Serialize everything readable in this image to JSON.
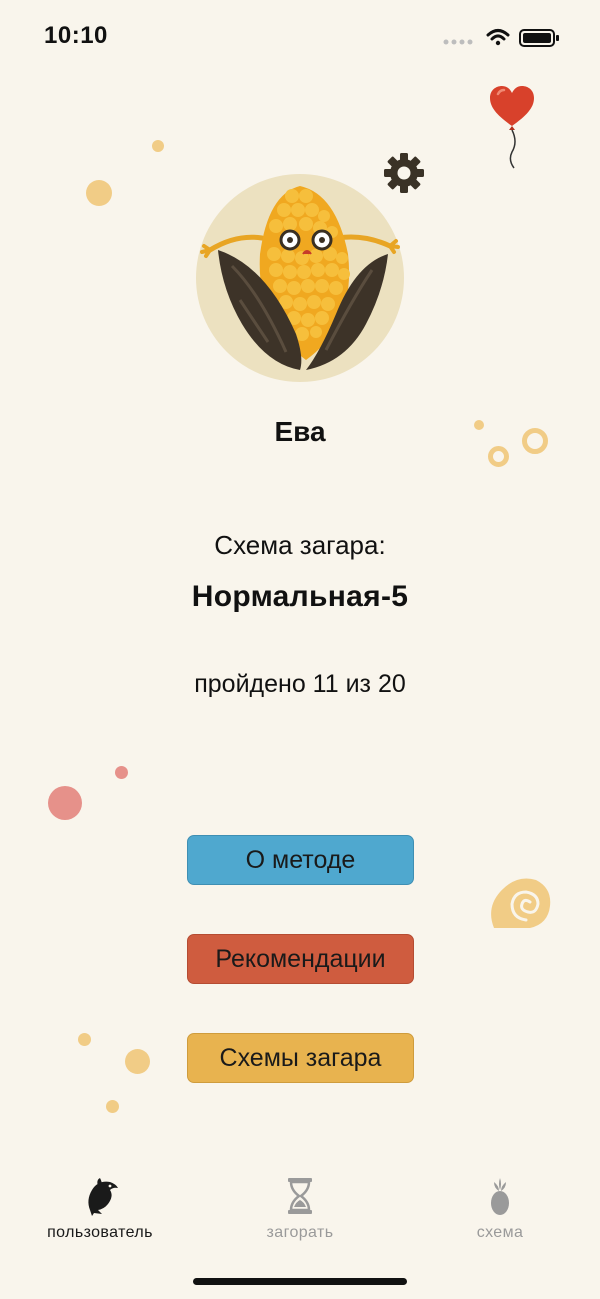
{
  "status_bar": {
    "time": "10:10"
  },
  "profile": {
    "name": "Ева"
  },
  "scheme": {
    "label": "Схема загара:",
    "name": "Нормальная-5",
    "progress_text": "пройдено 11 из 20",
    "completed": 11,
    "total": 20
  },
  "buttons": [
    {
      "label": "О методе",
      "color": "#4fa8cf"
    },
    {
      "label": "Рекомендации",
      "color": "#cf5c3f"
    },
    {
      "label": "Схемы загара",
      "color": "#e8b34f"
    }
  ],
  "tabs": [
    {
      "label": "пользователь",
      "icon": "dolphin-icon",
      "active": true
    },
    {
      "label": "загорать",
      "icon": "hourglass-icon",
      "active": false
    },
    {
      "label": "схема",
      "icon": "pineapple-icon",
      "active": false
    }
  ],
  "colors": {
    "background": "#f9f5ec",
    "tab_active": "#1a1a1a",
    "tab_inactive": "#9a9a9a"
  }
}
